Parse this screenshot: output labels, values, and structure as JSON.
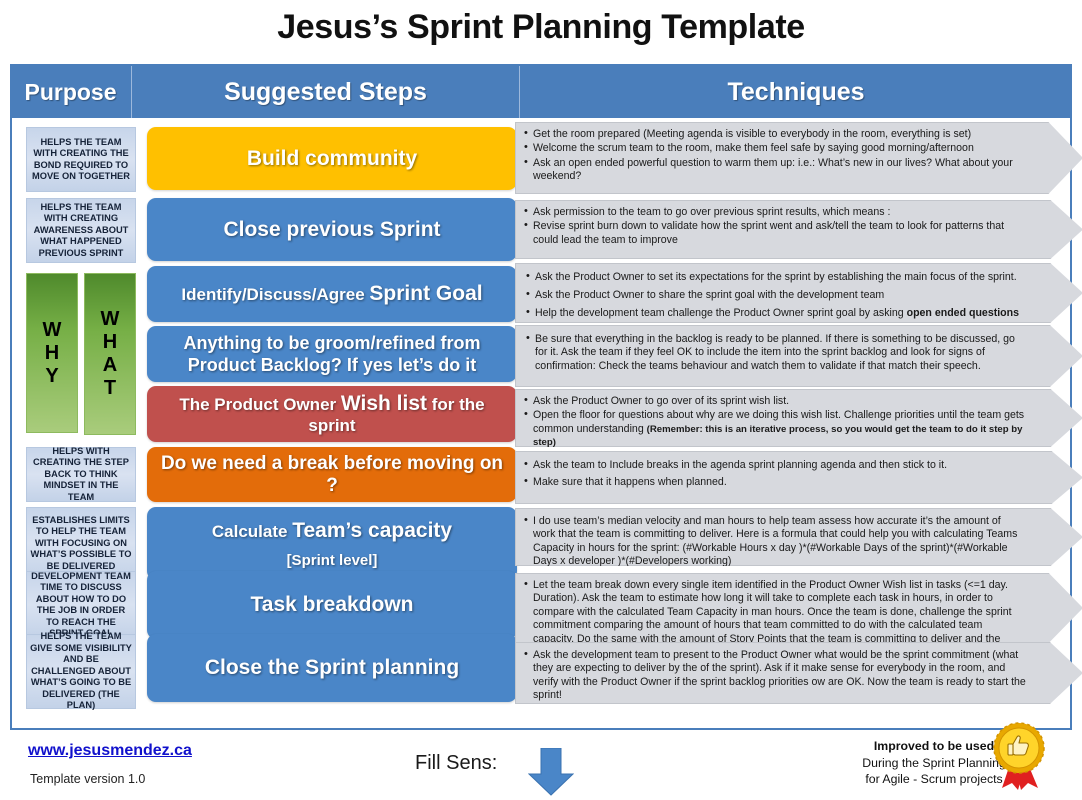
{
  "title": "Jesus’s Sprint Planning Template",
  "header": {
    "purpose": "Purpose",
    "steps": "Suggested Steps",
    "techniques": "Techniques"
  },
  "colors": {
    "header_blue": "#4A7EBB",
    "step_blue": "#4A86C8",
    "step_yellow": "#FFC000",
    "step_red": "#C0504D",
    "step_orange": "#E36C0A",
    "purpose_blue": "#D9E2F1",
    "green": "#76AF46",
    "technique_gray": "#D7D9DE",
    "link_blue": "#1111CC"
  },
  "side_labels": [
    {
      "id": "why",
      "letters": [
        "W",
        "H",
        "Y"
      ]
    },
    {
      "id": "what",
      "letters": [
        "W",
        "H",
        "A",
        "T"
      ]
    }
  ],
  "rows": [
    {
      "purpose": "Helps the team with creating the bond required to move on together",
      "step": {
        "lead": "",
        "big": "Build community",
        "sub": "",
        "color": "yellow"
      },
      "techniques": [
        "Get the room prepared (Meeting agenda is visible  to everybody in the room, everything is set)",
        "Welcome the scrum team to the room, make them feel safe by saying good morning/afternoon",
        "Ask an open ended powerful question to warm them up: i.e.: What’s new in our lives? What about your weekend?"
      ]
    },
    {
      "purpose": "Helps the team with creating awareness about what happened previous sprint",
      "step": {
        "lead": "",
        "big": "Close previous Sprint",
        "sub": "",
        "color": "blue"
      },
      "techniques": [
        "Ask permission to the team to go over previous sprint results, which means :",
        "Revise sprint burn down to validate how the sprint went and ask/tell the team  to look for patterns that could lead the team to improve"
      ]
    },
    {
      "purpose": "",
      "step": {
        "lead": "Identify/Discuss/Agree ",
        "big": "Sprint Goal",
        "sub": "",
        "color": "blue"
      },
      "techniques": [
        "Ask the Product Owner to set its expectations for the sprint by establishing the main focus of the sprint.",
        "Ask the Product Owner to share the sprint goal with the development team",
        "Help the development team challenge the Product Owner sprint goal by asking open ended questions"
      ],
      "techniques_bold_tail": "open ended questions"
    },
    {
      "purpose": "",
      "step": {
        "lead": "",
        "big": "",
        "two": "Anything to be groom/refined from Product Backlog? If yes let’s do it",
        "sub": "",
        "color": "blue"
      },
      "techniques": [
        "Be sure that everything in the backlog is ready to be planned. If there is something to  be discussed, go for it. Ask the team if they feel OK to include the item into the sprint backlog and look for signs of confirmation: Check the teams behaviour and watch them to validate if that match their speech."
      ]
    },
    {
      "purpose": "",
      "step": {
        "lead": "The Product Owner ",
        "big": "Wish list",
        "tail": " for the sprint",
        "sub": "",
        "color": "red"
      },
      "techniques": [
        "Ask the Product Owner to go over of its sprint wish list.",
        "Open the floor for questions about why are we doing this wish list. Challenge priorities until the team gets common understanding (Remember: this is an iterative process, so you would get the team to do it step by step)"
      ]
    },
    {
      "purpose": "Helps with creating the step back to think mindset in the team",
      "step": {
        "lead": "",
        "big": "Do we need a break before moving on ?",
        "sub": "",
        "color": "orange"
      },
      "techniques": [
        "Ask the team to Include breaks in the agenda sprint planning agenda and then stick to it.",
        "Make sure that it happens when planned."
      ]
    },
    {
      "purpose": "Establishes limits to help the team with focusing on what’s possible to be delivered",
      "step": {
        "lead": "Calculate ",
        "big": "Team’s capacity",
        "sub": "[Sprint level]",
        "color": "blue"
      },
      "techniques": [
        "I do use team’s median  velocity and man hours to help  team assess how accurate it’s the amount of work that the team is committing to deliver. Here is  a formula that could help you with calculating Teams Capacity in hours for the sprint: (#Workable Hours x day )*(#Workable Days of the sprint)*(#Workable Days x developer )*(#Developers working)"
      ]
    },
    {
      "purpose": "Development team time to discuss about how to do the job in order to reach the sprint goal",
      "step": {
        "lead": "",
        "big": "Task breakdown",
        "sub": "",
        "color": "blue"
      },
      "techniques": [
        "Let the team break down every single item identified in the Product Owner Wish list in tasks (<=1 day. Duration). Ask the team to estimate how long it will take to complete each task in hours, in order to compare with the calculated Team Capacity in man hours. Once the team is done, challenge the sprint commitment comparing the amount of hours that team committed to do with the calculated team capacity. Do the same with the amount of Story Points that the team is committing to deliver and the median Velocity of the team."
      ]
    },
    {
      "purpose": "Helps the team give some visibility and be challenged about what’s going to be delivered (the plan)",
      "step": {
        "lead": "",
        "big": "Close the Sprint planning",
        "sub": "",
        "color": "blue"
      },
      "techniques": [
        "Ask the development team to present to the Product Owner  what would be the sprint commitment (what they are expecting to deliver by the of the sprint). Ask if it make sense for everybody in the room, and verify with the Product Owner if the sprint backlog priorities  ow are OK.  Now the team is ready to start the sprint!"
      ]
    }
  ],
  "footer": {
    "site": "www.jesusmendez.ca",
    "version": "Template version 1.0",
    "fill_sens": "Fill Sens:",
    "note_line1": "Improved to be used",
    "note_line2": "During the Sprint Planning",
    "note_line3": "for Agile - Scrum projects",
    "badge_text": "RECOMMENDED"
  }
}
